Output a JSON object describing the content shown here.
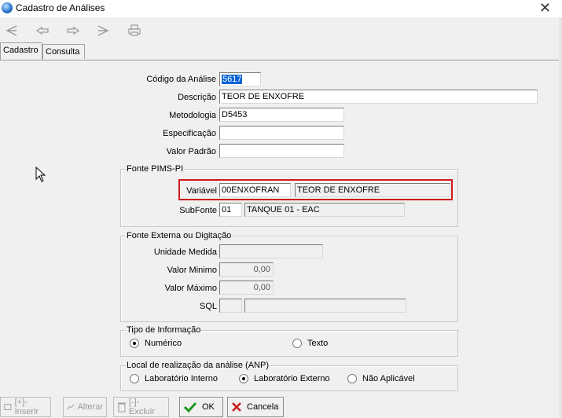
{
  "window": {
    "title": "Cadastro de Análises"
  },
  "tabs": [
    {
      "label": "Cadastro"
    },
    {
      "label": "Consulta"
    }
  ],
  "form": {
    "codigo_label": "Código da Análise",
    "codigo_value": "5617",
    "descricao_label": "Descrição",
    "descricao_value": "TEOR DE ENXOFRE",
    "metodologia_label": "Metodologia",
    "metodologia_value": "D5453",
    "especificacao_label": "Especificação",
    "especificacao_value": "",
    "valor_padrao_label": "Valor Padrão",
    "valor_padrao_value": ""
  },
  "fonte_pims": {
    "legend": "Fonte PIMS-PI",
    "variavel_label": "Variável",
    "variavel_code": "00ENXOFRAN",
    "variavel_desc": "TEOR DE ENXOFRE",
    "subfonte_label": "SubFonte",
    "subfonte_code": "01",
    "subfonte_desc": "TANQUE 01 - EAC"
  },
  "fonte_externa": {
    "legend": "Fonte Externa ou Digitação",
    "unidade_label": "Unidade Medida",
    "unidade_value": "",
    "valor_min_label": "Valor Minimo",
    "valor_min_value": "0,00",
    "valor_max_label": "Valor Máximo",
    "valor_max_value": "0,00",
    "sql_label": "SQL",
    "sql_code": "",
    "sql_desc": ""
  },
  "tipo_info": {
    "legend": "Tipo de Informação",
    "options": [
      {
        "label": "Numérico",
        "checked": true
      },
      {
        "label": "Texto",
        "checked": false
      }
    ]
  },
  "local_analise": {
    "legend": "Local de realização da análise (ANP)",
    "options": [
      {
        "label": "Laboratório Interno",
        "checked": false
      },
      {
        "label": "Laboratório Externo",
        "checked": true
      },
      {
        "label": "Não Aplicável",
        "checked": false
      }
    ]
  },
  "buttons": {
    "inserir": "[+]-Inserir",
    "alterar": "Alterar",
    "excluir": "[-]-Excluir",
    "ok": "OK",
    "cancela": "Cancela"
  },
  "colors": {
    "highlight": "#d01a1a",
    "selection": "#0a64d6",
    "ok_green": "#1f9a1f",
    "cancel_red": "#c81e1e"
  },
  "icons": [
    "app-icon",
    "first-record-icon",
    "prev-record-icon",
    "next-record-icon",
    "last-record-icon",
    "print-icon",
    "close-icon",
    "mouse-cursor-icon"
  ]
}
